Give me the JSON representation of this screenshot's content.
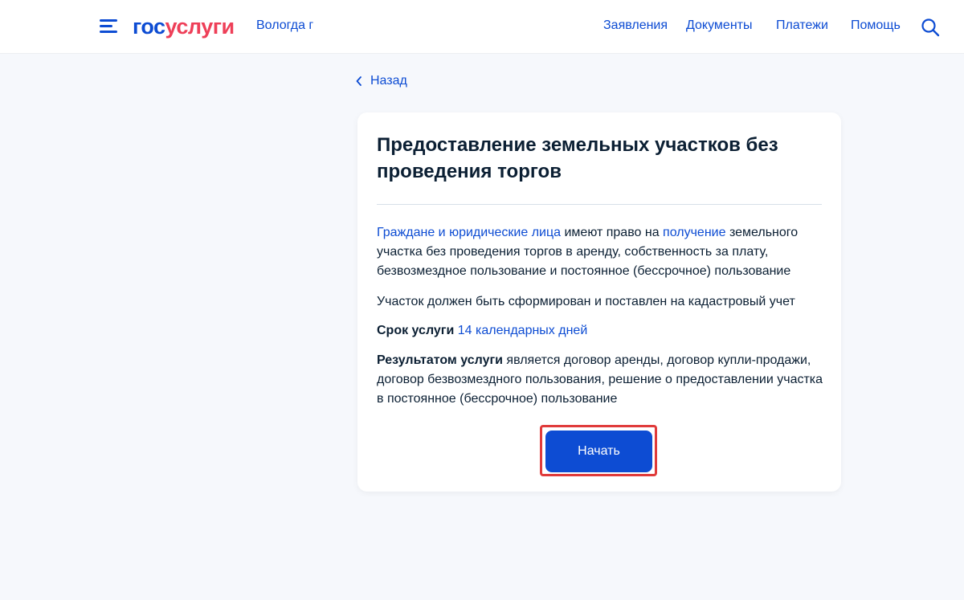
{
  "header": {
    "logo_part1": "гос",
    "logo_part2": "услуги",
    "region": "Вологда г",
    "nav": [
      "Заявления",
      "Документы",
      "Платежи",
      "Помощь"
    ],
    "colors": {
      "brand_blue": "#0d4cd3",
      "brand_red": "#ee3f58"
    },
    "icons": [
      "menu-icon",
      "search-icon"
    ]
  },
  "back": {
    "label": "Назад",
    "icon": "chevron-left-icon"
  },
  "card": {
    "title": "Предоставление земельных участков без проведения торгов",
    "intro": {
      "link1": "Граждане и юридические лица",
      "text1": " имеют право на ",
      "link2": "получение",
      "text2": " земельного участка без проведения торгов в аренду, собственность за плату, безвозмездное пользование и постоянное (бессрочное) пользование"
    },
    "requirement": "Участок должен быть сформирован и поставлен на кадастровый учет",
    "term": {
      "label": "Срок услуги",
      "value": "14 календарных дней"
    },
    "result": {
      "label": "Результатом услуги",
      "text": " является договор аренды, договор купли-продажи, договор безвозмездного пользования, решение о предоставлении участка в постоянное (бессрочное) пользование"
    },
    "start_button": "Начать"
  }
}
